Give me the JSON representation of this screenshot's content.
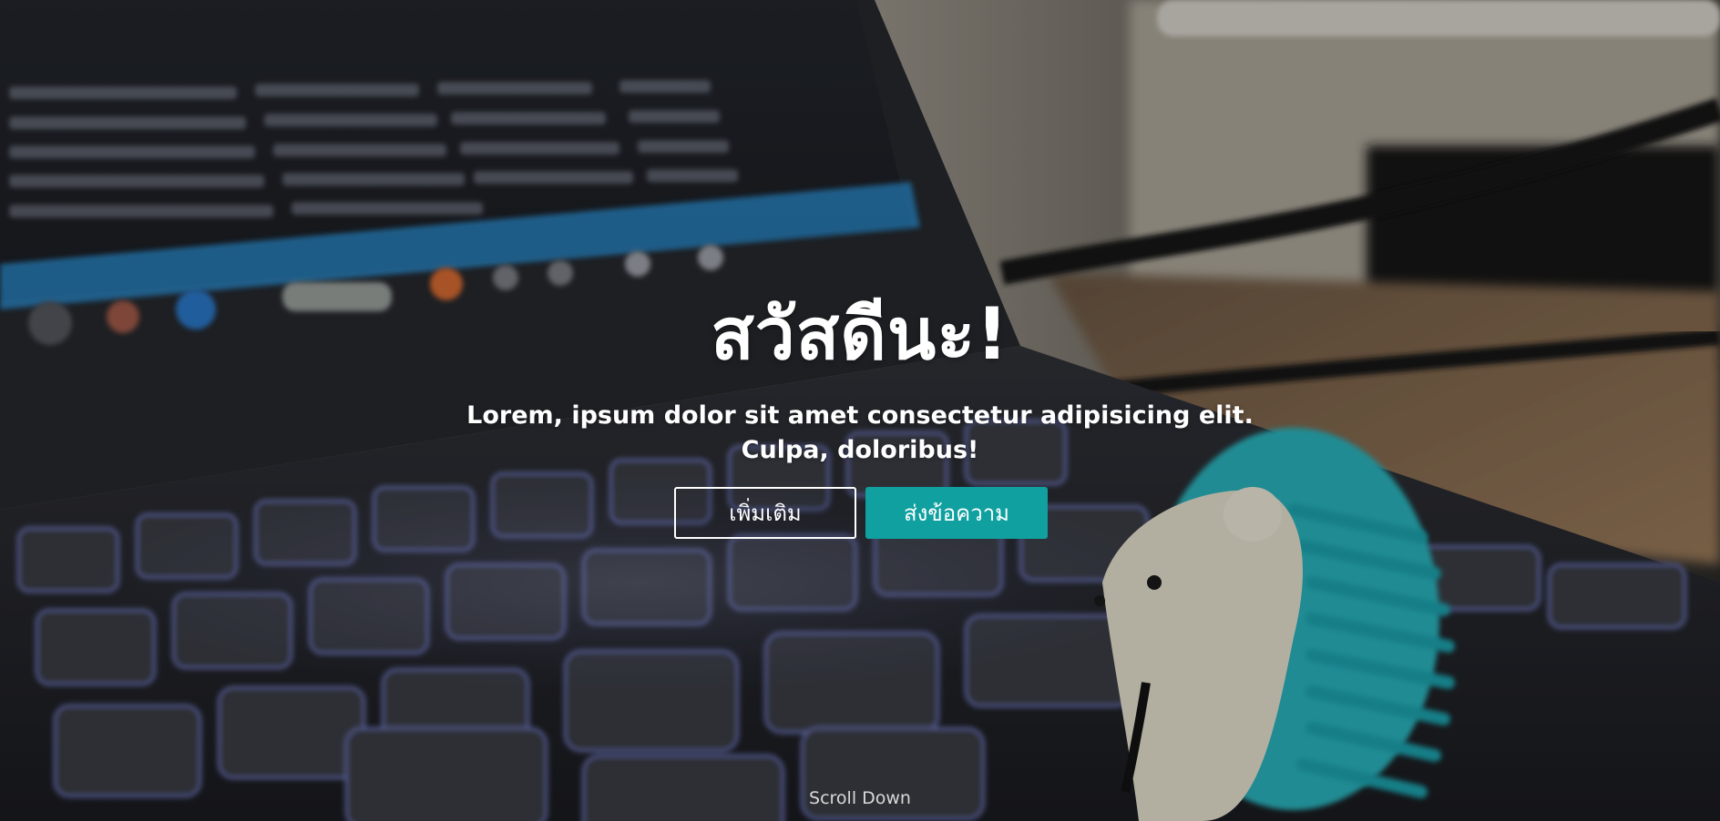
{
  "hero": {
    "title": "สวัสดีนะ!",
    "subtitle": "Lorem, ipsum dolor sit amet consectetur adipisicing elit. Culpa, doloribus!",
    "buttons": {
      "more_label": "เพิ่มเติม",
      "contact_label": "ส่งข้อความ"
    },
    "scroll_label": "Scroll Down"
  },
  "colors": {
    "accent": "#10a0a0",
    "text": "#ffffff"
  },
  "background": {
    "image": "laptop-keyboard-photo",
    "icon": "hedgehog-figurine"
  }
}
